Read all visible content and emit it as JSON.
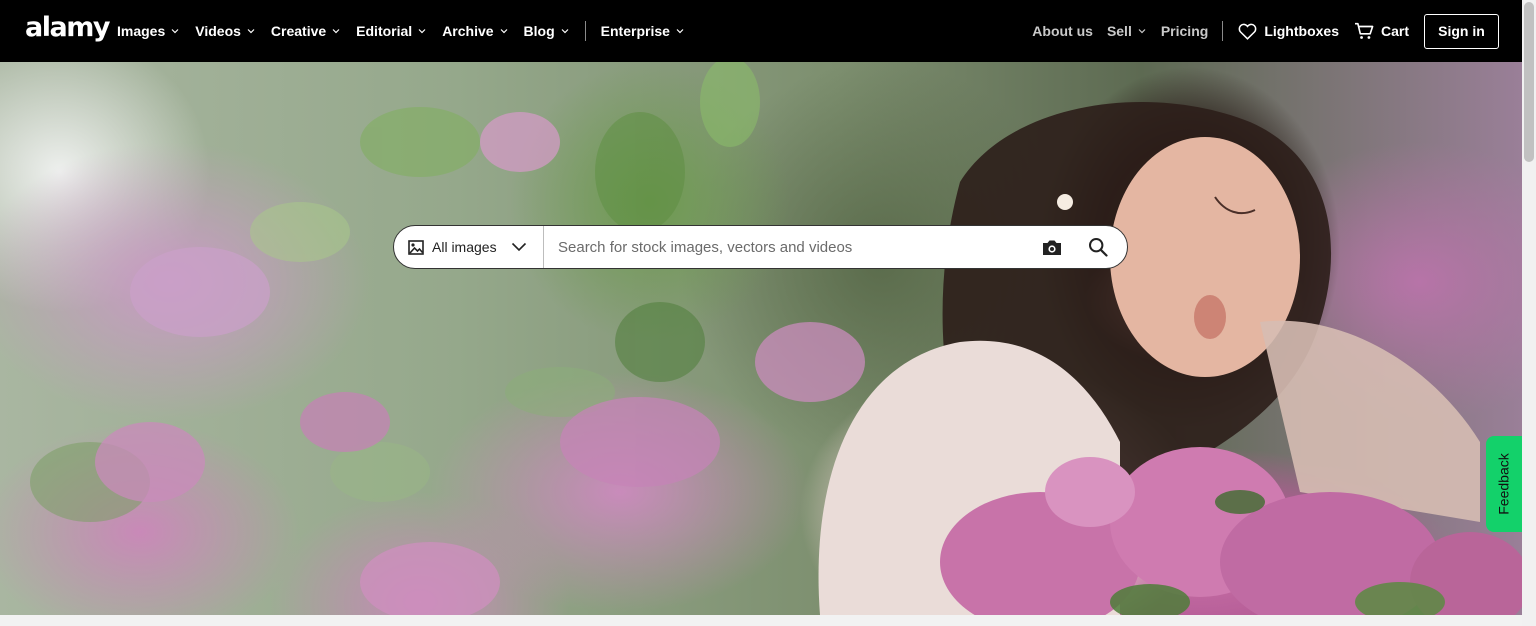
{
  "brand": {
    "logo_text": "alamy"
  },
  "nav": {
    "left_items": [
      {
        "label": "Images"
      },
      {
        "label": "Videos"
      },
      {
        "label": "Creative"
      },
      {
        "label": "Editorial"
      },
      {
        "label": "Archive"
      },
      {
        "label": "Blog"
      }
    ],
    "enterprise": {
      "label": "Enterprise"
    },
    "about": {
      "label": "About us"
    },
    "sell": {
      "label": "Sell"
    },
    "pricing": {
      "label": "Pricing"
    },
    "lightboxes": {
      "label": "Lightboxes",
      "icon": "heart-icon"
    },
    "cart": {
      "label": "Cart",
      "icon": "cart-icon"
    },
    "signin": {
      "label": "Sign in"
    }
  },
  "search": {
    "scope_label": "All images",
    "scope_icon": "image-icon",
    "placeholder": "Search for stock images, vectors and videos",
    "value": "",
    "camera_icon": "camera-icon",
    "search_icon": "search-icon"
  },
  "hero": {
    "image_description_icon": "hero-photo"
  },
  "feedback": {
    "label": "Feedback",
    "color": "#13d16a"
  },
  "colors": {
    "topbar": "#000000",
    "accent": "#13d16a"
  }
}
